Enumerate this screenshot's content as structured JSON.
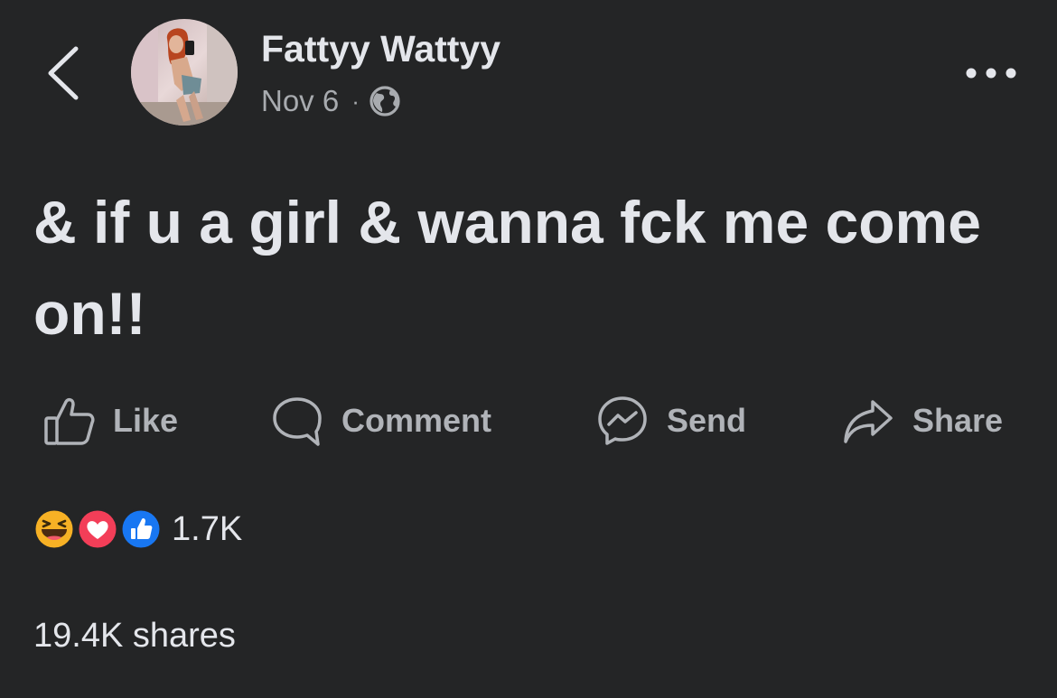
{
  "header": {
    "back_icon": "chevron-left-icon",
    "author_name": "Fattyy Wattyy",
    "post_date": "Nov 6",
    "separator": "·",
    "privacy_icon": "globe-icon",
    "more_icon": "more-options-icon"
  },
  "post": {
    "text": "& if u a girl & wanna fck me come on!!"
  },
  "actions": [
    {
      "label": "Like",
      "icon": "thumbs-up-icon"
    },
    {
      "label": "Comment",
      "icon": "comment-icon"
    },
    {
      "label": "Send",
      "icon": "messenger-icon"
    },
    {
      "label": "Share",
      "icon": "share-icon"
    }
  ],
  "engagement": {
    "reaction_icons": [
      "haha-reaction-icon",
      "love-reaction-icon",
      "like-reaction-icon"
    ],
    "reaction_count": "1.7K",
    "shares": "19.4K shares"
  },
  "colors": {
    "background": "#242526",
    "primary_text": "#e4e6eb",
    "secondary_text": "#b0b3b8",
    "like_blue": "#1877f2",
    "love_red": "#f33e58",
    "haha_yellow": "#f7b125"
  }
}
